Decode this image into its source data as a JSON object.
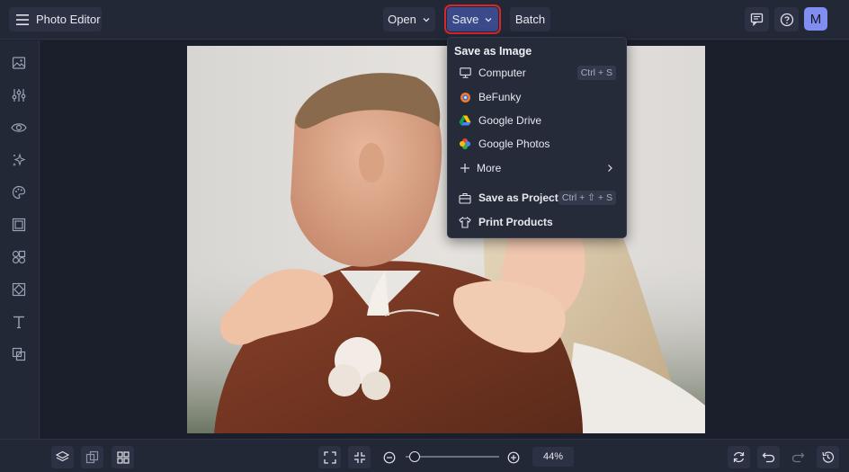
{
  "header": {
    "app_title": "Photo Editor",
    "open_label": "Open",
    "save_label": "Save",
    "batch_label": "Batch",
    "avatar_initial": "M",
    "accent_color": "#3a4a8a",
    "highlight_color": "#d9262c"
  },
  "sidebar": {
    "icons": [
      "image-icon",
      "adjustments-icon",
      "eye-icon",
      "sparkle-icon",
      "palette-icon",
      "frame-icon",
      "shapes-icon",
      "texture-icon",
      "text-icon",
      "overlay-icon"
    ]
  },
  "save_menu": {
    "header": "Save as Image",
    "items": [
      {
        "label": "Computer",
        "shortcut": "Ctrl + S",
        "icon": "monitor-icon"
      },
      {
        "label": "BeFunky",
        "icon": "befunky-icon"
      },
      {
        "label": "Google Drive",
        "icon": "google-drive-icon"
      },
      {
        "label": "Google Photos",
        "icon": "google-photos-icon"
      },
      {
        "label": "More",
        "icon": "plus-icon"
      }
    ],
    "project_items": [
      {
        "label": "Save as Project",
        "shortcut": "Ctrl + ⇧ + S",
        "icon": "briefcase-icon"
      },
      {
        "label": "Print Products",
        "icon": "tshirt-icon"
      }
    ]
  },
  "bottom": {
    "zoom_value": "44%",
    "zoom_fraction": 0.1
  }
}
